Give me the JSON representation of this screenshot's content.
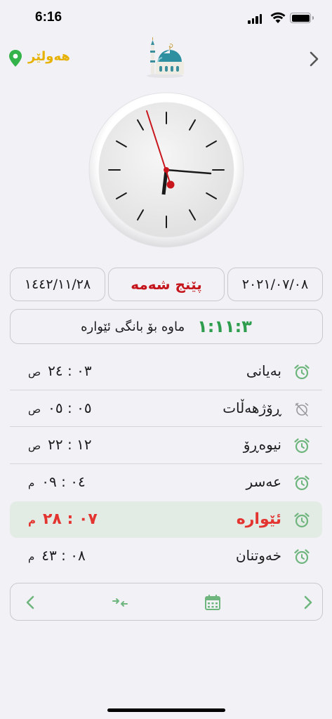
{
  "status": {
    "time": "6:16"
  },
  "header": {
    "city": "هەولێر"
  },
  "dates": {
    "hijri": "١٤٤٢/١١/٢٨",
    "weekday": "پێنج شەمە",
    "gregorian": "٢٠٢١/٠٧/٠٨"
  },
  "countdown": {
    "label": "ماوە بۆ بانگی ئێوارە",
    "time": "١:١١:٣"
  },
  "prayers": [
    {
      "name": "بەیانی",
      "time": "٠٣ : ٢٤",
      "ampm": "ص",
      "alarm": "on"
    },
    {
      "name": "ڕۆژهەڵات",
      "time": "٠٥ : ٠٥",
      "ampm": "ص",
      "alarm": "off"
    },
    {
      "name": "نیوەڕۆ",
      "time": "١٢ : ٢٢",
      "ampm": "ص",
      "alarm": "on"
    },
    {
      "name": "عەسر",
      "time": "٠٤ : ٠٩",
      "ampm": "م",
      "alarm": "on"
    },
    {
      "name": "ئێوارە",
      "time": "٠٧ : ٢٨",
      "ampm": "م",
      "alarm": "on",
      "active": true
    },
    {
      "name": "خەوتنان",
      "time": "٠٨ : ٤٣",
      "ampm": "م",
      "alarm": "on"
    }
  ],
  "colors": {
    "accent_green": "#2e9d4e",
    "alarm_green": "#6fb57e",
    "highlight_red": "#e3342f",
    "weekday_red": "#c4161c",
    "city_yellow": "#e6b100",
    "active_row_bg": "#e3ebe5"
  },
  "icons": {
    "location": "location-pin-icon",
    "forward": "chevron-right-icon",
    "alarm_on": "alarm-clock-icon",
    "alarm_off": "alarm-off-icon",
    "prev": "chevron-left-icon",
    "swap": "swap-arrows-icon",
    "calendar": "calendar-icon",
    "next": "chevron-right-icon"
  }
}
